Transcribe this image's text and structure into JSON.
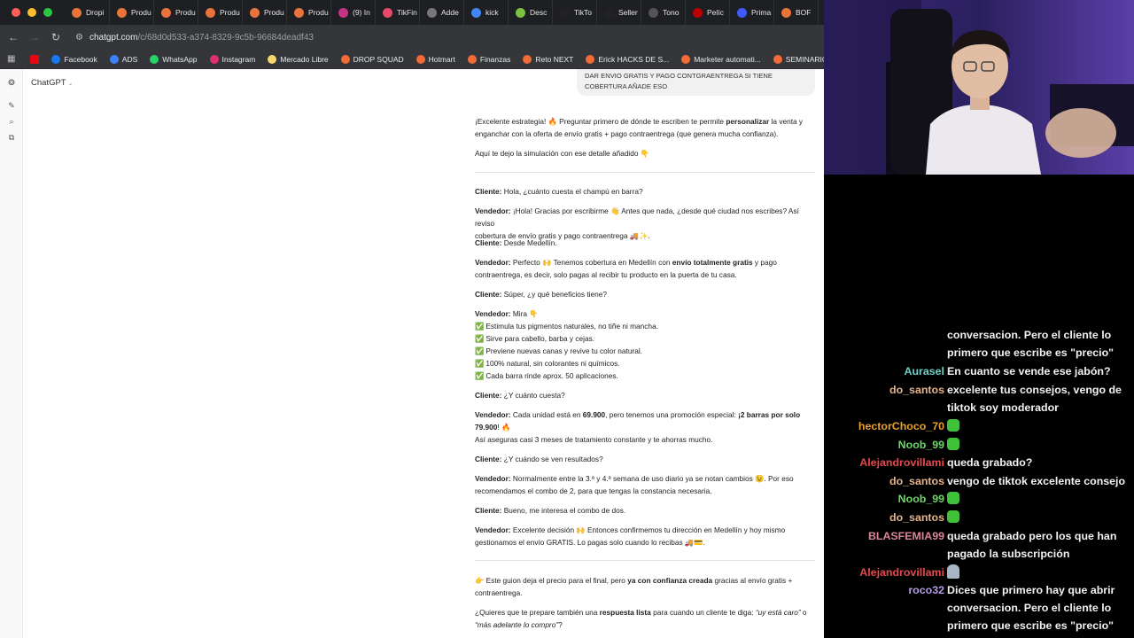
{
  "browser": {
    "tabs": [
      "Dropi",
      "Produ",
      "Produ",
      "Produ",
      "Produ",
      "Produ",
      "(9) In",
      "TikFin",
      "Adde",
      "kick",
      "Desc",
      "TikTo",
      "Seller",
      "Tono",
      "Pelíc",
      "Prima",
      "BOF"
    ],
    "url_host": "chatgpt.com",
    "url_path": "/c/68d0d533-a374-8329-9c5b-96684deadf43",
    "bookmarks": [
      "Facebook",
      "ADS",
      "WhatsApp",
      "Instagram",
      "Mercado Libre",
      "DROP SQUAD",
      "Hotmart",
      "Finanzas",
      "Reto NEXT",
      "Erick HACKS DE S...",
      "Marketer automati...",
      "SEMINARIOS ONLI..."
    ]
  },
  "chatgpt": {
    "model_label": "ChatGPT",
    "user_bubble": [
      "DAR ENVIO GRATIS Y PAGO CONTGRAENTREGA SI TIENE",
      "COBERTURA AÑADE ESO"
    ],
    "intro_1a": "¡Excelente estrategia! 🔥 Preguntar primero de dónde te escriben te permite ",
    "intro_1b": "personalizar",
    "intro_1c": " la venta y",
    "intro_2": "enganchar con la oferta de envío gratis + pago contraentrega (que genera mucha confianza).",
    "intro_3": "Aquí te dejo la simulación con ese detalle añadido 👇",
    "cliente": "Cliente:",
    "vendedor": "Vendedor:",
    "m1": "Hola, ¿cuánto cuesta el champú en barra?",
    "m2a": "¡Hola! Gracias por escribirme 👋 Antes que nada, ¿desde qué ciudad nos escribes? Así reviso",
    "m2b": "cobertura de envío gratis y pago contraentrega 🚚✨.",
    "m3": "Desde Medellín.",
    "m4a": "Perfecto 🙌 Tenemos cobertura en Medellín con ",
    "m4b": "envío totalmente gratis",
    "m4c": " y pago",
    "m4d": "contraentrega, es decir, solo pagas al recibir tu producto en la puerta de tu casa.",
    "m5": "Súper, ¿y qué beneficios tiene?",
    "m6": "Mira 👇",
    "benefits": [
      "Estimula tus pigmentos naturales, no tiñe ni mancha.",
      "Sirve para cabello, barba y cejas.",
      "Previene nuevas canas y revive tu color natural.",
      "100% natural, sin colorantes ni químicos.",
      "Cada barra rinde aprox. 50 aplicaciones."
    ],
    "check": "✅",
    "m7": "¿Y cuánto cuesta?",
    "m8a": "Cada unidad está en ",
    "m8b": "69.900",
    "m8c": ", pero tenemos una promoción especial: ",
    "m8d": "¡2 barras por solo",
    "m8e": "79.900",
    "m8f": "! 🔥",
    "m8g": "Así aseguras casi 3 meses de tratamiento constante y te ahorras mucho.",
    "m9": "¿Y cuándo se ven resultados?",
    "m10a": "Normalmente entre la 3.ª y 4.ª semana de uso diario ya se notan cambios 😉. Por eso",
    "m10b": "recomendamos el combo de 2, para que tengas la constancia necesaria.",
    "m11": "Bueno, me interesa el combo de dos.",
    "m12a": "Excelente decisión 🙌 Entonces confirmemos tu dirección en Medellín y hoy mismo",
    "m12b": "gestionamos el envío GRATIS. Lo pagas solo cuando lo recibas 🚚💳.",
    "out1a": "👉 Este guion deja el precio para el final, pero ",
    "out1b": "ya con confianza creada",
    "out1c": " gracias al envío gratis +",
    "out1d": "contraentrega.",
    "out2a": "¿Quieres que te prepare también una ",
    "out2b": "respuesta lista",
    "out2c": " para cuando un cliente te diga: ",
    "out2d": "“uy está caro”",
    "out2e": " o",
    "out2f": "“más adelante lo compro”",
    "out2g": "?"
  },
  "stream_chat": {
    "messages": [
      {
        "user": "",
        "color": "#ffffff",
        "lines": [
          "conversacion. Pero el cliente lo",
          "primero que escribe es \"precio\""
        ]
      },
      {
        "user": "Aurasel",
        "color": "#6fd1c8",
        "lines": [
          "En cuanto se vende ese jabón?"
        ]
      },
      {
        "user": "do_santos",
        "color": "#e4b48a",
        "lines": [
          "excelente tus consejos, vengo de",
          "tiktok soy moderador"
        ]
      },
      {
        "user": "hectorChoco_70",
        "color": "#e8a02c",
        "lines": [
          ""
        ],
        "emote": "green"
      },
      {
        "user": "Noob_99",
        "color": "#6fd46a",
        "lines": [
          ""
        ],
        "emote": "green"
      },
      {
        "user": "Alejandrovillami",
        "color": "#e8484c",
        "lines": [
          "queda grabado?"
        ]
      },
      {
        "user": "do_santos",
        "color": "#e4b48a",
        "lines": [
          "vengo de tiktok excelente consejo"
        ]
      },
      {
        "user": "Noob_99",
        "color": "#6fd46a",
        "lines": [
          ""
        ],
        "emote": "green"
      },
      {
        "user": "do_santos",
        "color": "#e4b48a",
        "lines": [
          ""
        ],
        "emote": "green"
      },
      {
        "user": "BLASFEMIA99",
        "color": "#d9849a",
        "lines": [
          "queda grabado pero los que han",
          "pagado la subscripción"
        ]
      },
      {
        "user": "Alejandrovillami",
        "color": "#e8484c",
        "lines": [
          ""
        ],
        "emote": "grey"
      },
      {
        "user": "roco32",
        "color": "#b59ae6",
        "lines": [
          "Dices que primero hay que abrir",
          "conversacion. Pero el cliente lo",
          "primero que escribe es \"precio\""
        ]
      }
    ]
  }
}
